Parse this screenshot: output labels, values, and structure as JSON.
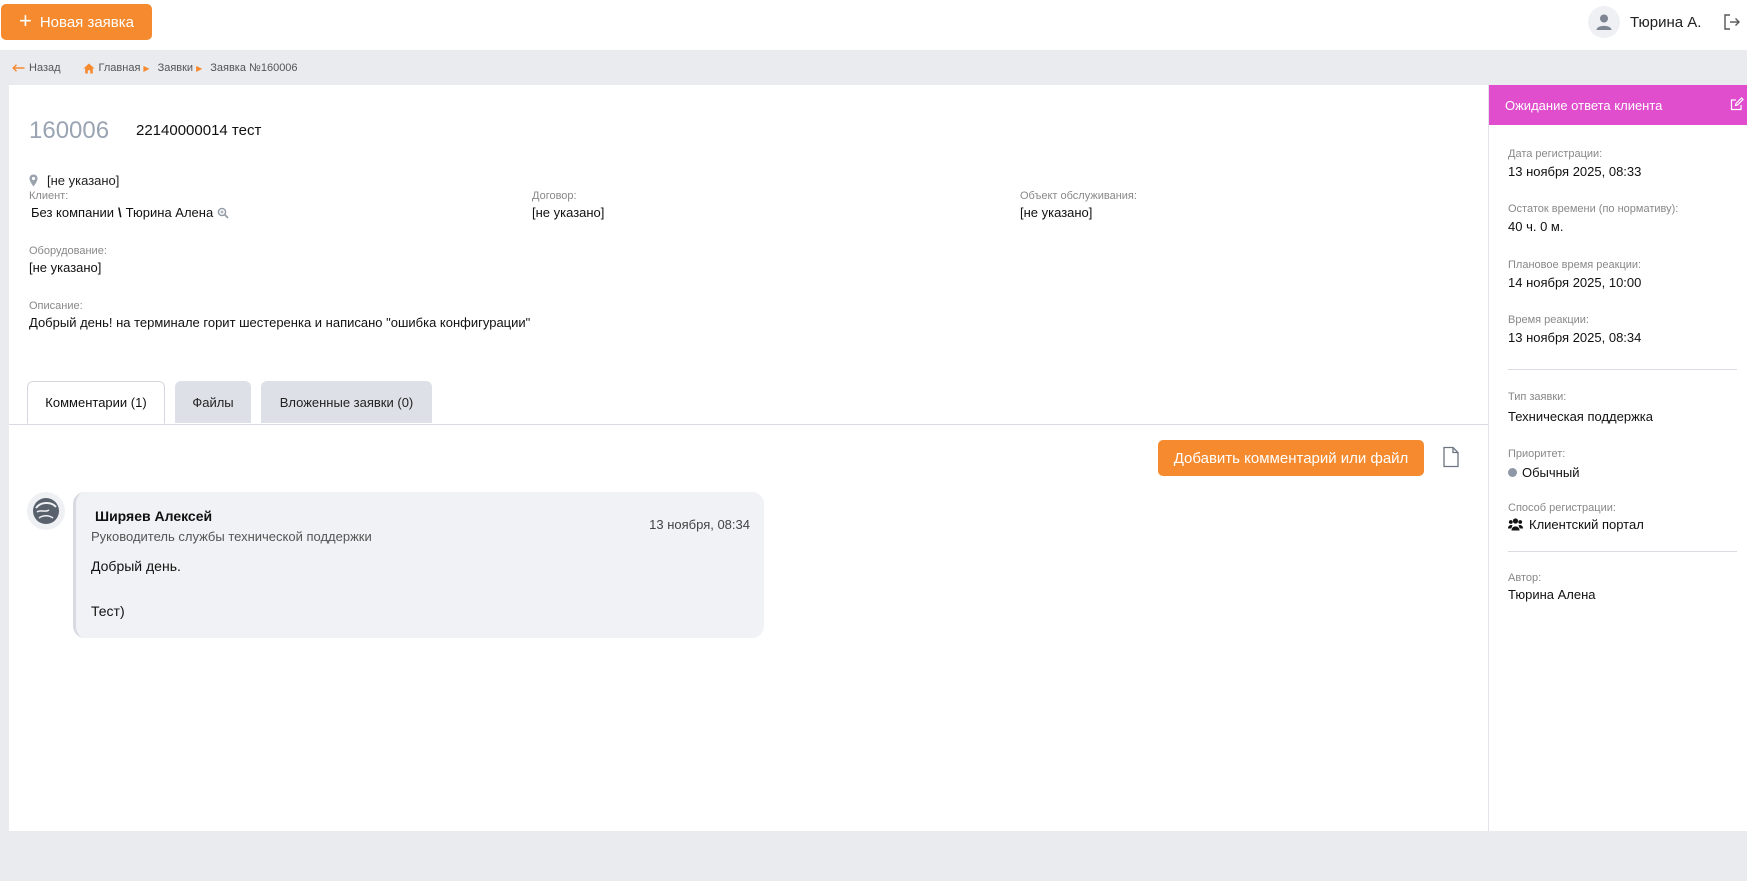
{
  "header": {
    "new_ticket_label": "Новая заявка",
    "user_name": "Тюрина А."
  },
  "breadcrumb": {
    "back": "Назад",
    "home": "Главная",
    "tickets": "Заявки",
    "current": "Заявка №160006"
  },
  "ticket": {
    "id": "160006",
    "title": "22140000014 тест",
    "location": "[не указано]",
    "client_label": "Клиент:",
    "client_company": "Без компании",
    "client_name": "Тюрина Алена",
    "contract_label": "Договор:",
    "contract_value": "[не указано]",
    "service_object_label": "Объект обслуживания:",
    "service_object_value": "[не указано]",
    "equipment_label": "Оборудование:",
    "equipment_value": "[не указано]",
    "description_label": "Описание:",
    "description_value": "Добрый день! на терминале горит шестеренка и написано \"ошибка конфигурации\""
  },
  "tabs": [
    {
      "label": "Комментарии (1)",
      "active": true
    },
    {
      "label": "Файлы",
      "active": false
    },
    {
      "label": "Вложенные заявки (0)",
      "active": false
    }
  ],
  "comments_panel": {
    "add_button_label": "Добавить комментарий или файл",
    "items": [
      {
        "author": "Ширяев Алексей",
        "role": "Руководитель службы технической поддержки",
        "time": "13 ноября, 08:34",
        "line1": "Добрый день.",
        "line2": "Тест)"
      }
    ]
  },
  "side": {
    "status": "Ожидание ответа клиента",
    "status_color": "#e04dcd",
    "registration_date_label": "Дата регистрации:",
    "registration_date": "13 ноября 2025, 08:33",
    "time_left_label": "Остаток времени (по нормативу):",
    "time_left": "40 ч. 0 м.",
    "planned_reaction_label": "Плановое время реакции:",
    "planned_reaction": "14 ноября 2025, 10:00",
    "reaction_label": "Время реакции:",
    "reaction": "13 ноября 2025, 08:34",
    "type_label": "Тип заявки:",
    "type": "Техническая поддержка",
    "priority_label": "Приоритет:",
    "priority": "Обычный",
    "reg_method_label": "Способ регистрации:",
    "reg_method": "Клиентский портал",
    "author_label": "Автор:",
    "author": "Тюрина Алена"
  },
  "colors": {
    "accent": "#f58a2e",
    "status": "#e04dcd",
    "background": "#e9ebef"
  }
}
